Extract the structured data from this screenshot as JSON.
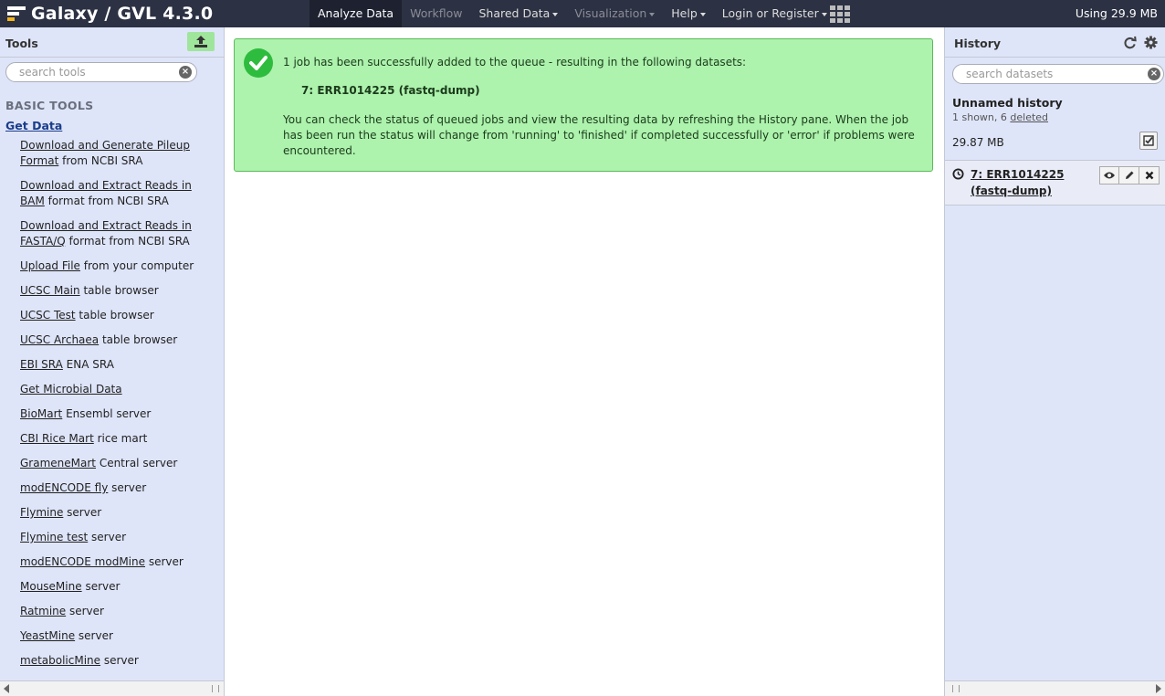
{
  "masthead": {
    "brand": "Galaxy / GVL 4.3.0",
    "nav": [
      {
        "label": "Analyze Data",
        "state": "active",
        "caret": false
      },
      {
        "label": "Workflow",
        "state": "disabled",
        "caret": false
      },
      {
        "label": "Shared Data",
        "state": "normal",
        "caret": true
      },
      {
        "label": "Visualization",
        "state": "disabled",
        "caret": true
      },
      {
        "label": "Help",
        "state": "normal",
        "caret": true
      },
      {
        "label": "Login or Register",
        "state": "normal",
        "caret": true
      }
    ],
    "quota": "Using 29.9 MB"
  },
  "tools_panel": {
    "title": "Tools",
    "search_placeholder": "search tools",
    "section": "BASIC TOOLS",
    "group": "Get Data",
    "tools": [
      {
        "link": "Download and Generate Pileup Format",
        "rest": " from NCBI SRA"
      },
      {
        "link": "Download and Extract Reads in BAM",
        "rest": " format from NCBI SRA"
      },
      {
        "link": "Download and Extract Reads in FASTA/Q",
        "rest": " format from NCBI SRA"
      },
      {
        "link": "Upload File",
        "rest": " from your computer"
      },
      {
        "link": "UCSC Main",
        "rest": " table browser"
      },
      {
        "link": "UCSC Test",
        "rest": " table browser"
      },
      {
        "link": "UCSC Archaea",
        "rest": " table browser"
      },
      {
        "link": "EBI SRA",
        "rest": " ENA SRA"
      },
      {
        "link": "Get Microbial Data",
        "rest": ""
      },
      {
        "link": "BioMart",
        "rest": " Ensembl server"
      },
      {
        "link": "CBI Rice Mart",
        "rest": " rice mart"
      },
      {
        "link": "GrameneMart",
        "rest": " Central server"
      },
      {
        "link": "modENCODE fly",
        "rest": " server"
      },
      {
        "link": "Flymine",
        "rest": " server"
      },
      {
        "link": "Flymine test",
        "rest": " server"
      },
      {
        "link": "modENCODE modMine",
        "rest": " server"
      },
      {
        "link": "MouseMine",
        "rest": " server"
      },
      {
        "link": "Ratmine",
        "rest": " server"
      },
      {
        "link": "YeastMine",
        "rest": " server"
      },
      {
        "link": "metabolicMine",
        "rest": " server"
      }
    ]
  },
  "message": {
    "line1": "1 job has been successfully added to the queue - resulting in the following datasets:",
    "dataset": "7: ERR1014225 (fastq-dump)",
    "paragraph": "You can check the status of queued jobs and view the resulting data by refreshing the History pane. When the job has been run the status will change from 'running' to 'finished' if completed successfully or 'error' if problems were encountered."
  },
  "history_panel": {
    "title": "History",
    "search_placeholder": "search datasets",
    "name": "Unnamed history",
    "shown": "1 shown, 6 ",
    "deleted_link": "deleted",
    "size": "29.87 MB",
    "dataset_title": "7: ERR1014225 (fastq-dump)"
  }
}
